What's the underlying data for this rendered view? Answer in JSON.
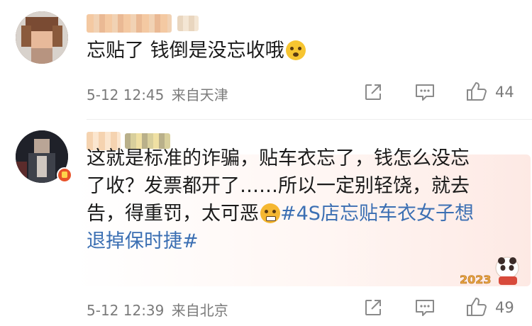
{
  "comments": [
    {
      "text_before_emoji": "忘贴了 钱倒是没忘收哦",
      "emoji": "surprised-face",
      "date": "5-12 12:45",
      "location": "来自天津",
      "likes": "44"
    },
    {
      "line1": "这就是标准的诈骗，贴车衣忘了，钱怎么没忘",
      "line2": "了收？发票都开了……所以一定别轻饶，就去",
      "line3_text": "告，得重罚，太可恶",
      "emoji": "angry-face",
      "topic_part1": "#4S店忘贴车衣女子想",
      "topic_part2": "退掉保时捷#",
      "date": "5-12 12:39",
      "location": "来自北京",
      "likes": "49",
      "decoration_text": "2023"
    }
  ],
  "colors": {
    "topic": "#3b6fb3",
    "meta": "#7b7b7b",
    "highlight": "#fde9e4"
  }
}
